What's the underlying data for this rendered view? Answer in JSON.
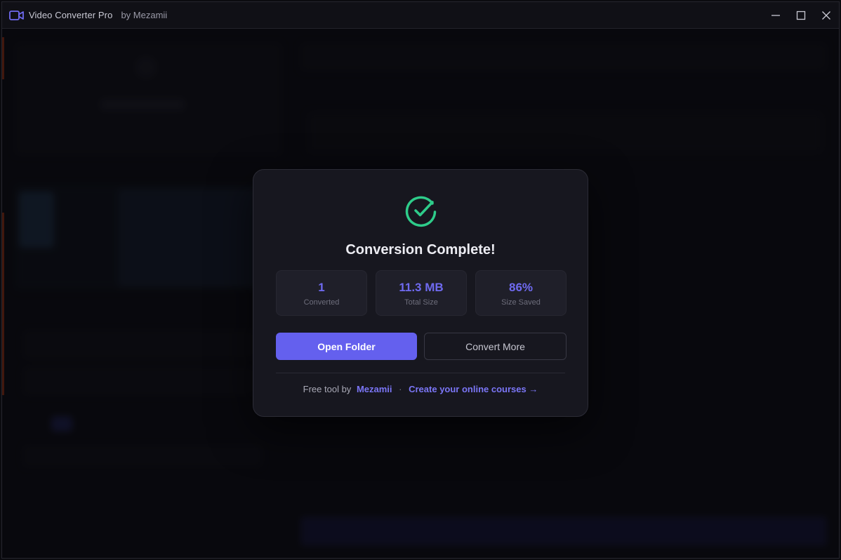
{
  "window": {
    "title": "Video Converter Pro",
    "subtitle": "by Mezamii",
    "icon": "video-camera-icon",
    "controls": [
      "minimize-icon",
      "maximize-icon",
      "close-icon"
    ]
  },
  "modal": {
    "icon": "check-circle-icon",
    "title": "Conversion Complete!",
    "stats": [
      {
        "value": "1",
        "label": "Converted"
      },
      {
        "value": "11.3 MB",
        "label": "Total Size"
      },
      {
        "value": "86%",
        "label": "Size Saved"
      }
    ],
    "primary_button": "Open Folder",
    "secondary_button": "Convert More",
    "footer": {
      "prefix": "Free tool by",
      "brand": "Mezamii",
      "separator": "·",
      "cta": "Create your online courses →"
    }
  },
  "colors": {
    "accent": "#6460ee",
    "success": "#2ecc8a",
    "background": "#0d0d12",
    "modal": "#17171f"
  }
}
